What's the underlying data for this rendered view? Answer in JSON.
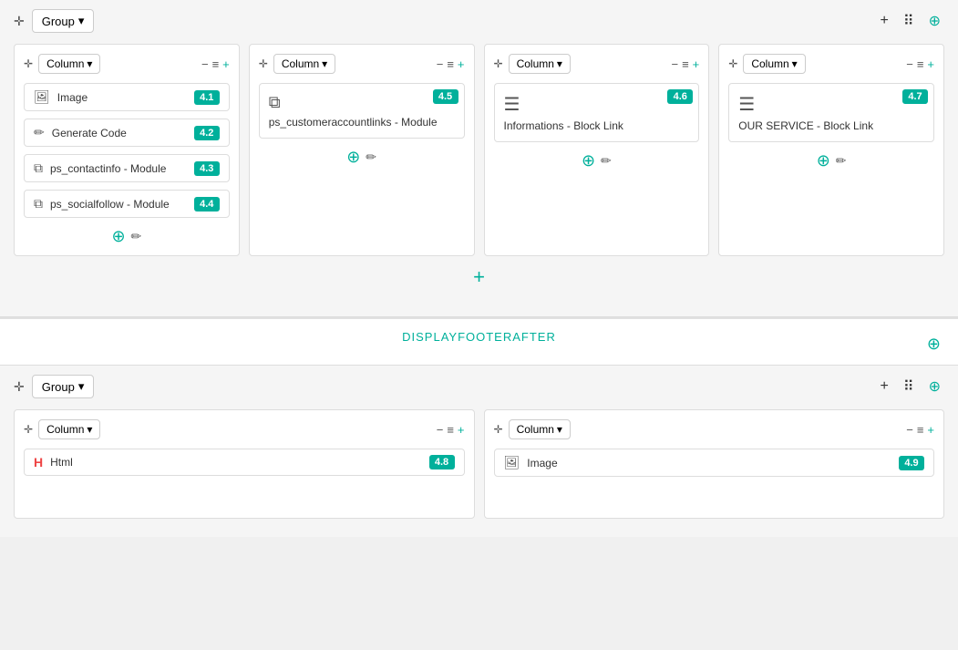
{
  "topGroup": {
    "dragLabel": "✛",
    "groupBtn": "Group",
    "dropdownArrow": "▾",
    "topRightIcons": [
      "+",
      "⠿",
      "⊕"
    ],
    "columns": [
      {
        "id": "col1",
        "columnBtn": "Column",
        "controls": [
          "−",
          "≡",
          "+"
        ],
        "items": [
          {
            "icon": "🖼",
            "label": "Image",
            "badge": "4.1"
          },
          {
            "icon": "✏",
            "label": "Generate Code",
            "badge": "4.2"
          },
          {
            "icon": "⧉",
            "label": "ps_contactinfo - Module",
            "badge": "4.3"
          },
          {
            "icon": "⧉",
            "label": "ps_socialfollow - Module",
            "badge": "4.4"
          }
        ],
        "hasAddEdit": true
      },
      {
        "id": "col2",
        "columnBtn": "Column",
        "controls": [
          "−",
          "≡",
          "+"
        ],
        "wideItem": {
          "icon": "⧉",
          "label": "ps_customeraccountlinks - Module",
          "badge": "4.5"
        },
        "hasAddEdit": true
      },
      {
        "id": "col3",
        "columnBtn": "Column",
        "controls": [
          "−",
          "≡",
          "+"
        ],
        "wideItem": {
          "icon": "≡",
          "label": "Informations - Block Link",
          "badge": "4.6"
        },
        "hasAddEdit": true
      },
      {
        "id": "col4",
        "columnBtn": "Column",
        "controls": [
          "−",
          "≡",
          "+"
        ],
        "wideItem": {
          "icon": "≡",
          "label": "OUR SERVICE - Block Link",
          "badge": "4.7"
        },
        "hasAddEdit": true
      }
    ]
  },
  "centerAdd": "+",
  "footerSectionLabel": "DISPLAYFOOTERAFTER",
  "footerSettingsIcon": "⊕",
  "footerGroup": {
    "dragLabel": "✛",
    "groupBtn": "Group",
    "dropdownArrow": "▾",
    "topRightIcons": [
      "+",
      "⠿",
      "⊕"
    ],
    "columns": [
      {
        "id": "fcol1",
        "columnBtn": "Column",
        "controls": [
          "−",
          "≡",
          "+"
        ],
        "items": [
          {
            "icon": "H",
            "label": "Html",
            "badge": "4.8"
          }
        ]
      },
      {
        "id": "fcol2",
        "columnBtn": "Column",
        "controls": [
          "−",
          "≡",
          "+"
        ],
        "items": [
          {
            "icon": "🖼",
            "label": "Image",
            "badge": "4.9"
          }
        ]
      }
    ]
  }
}
